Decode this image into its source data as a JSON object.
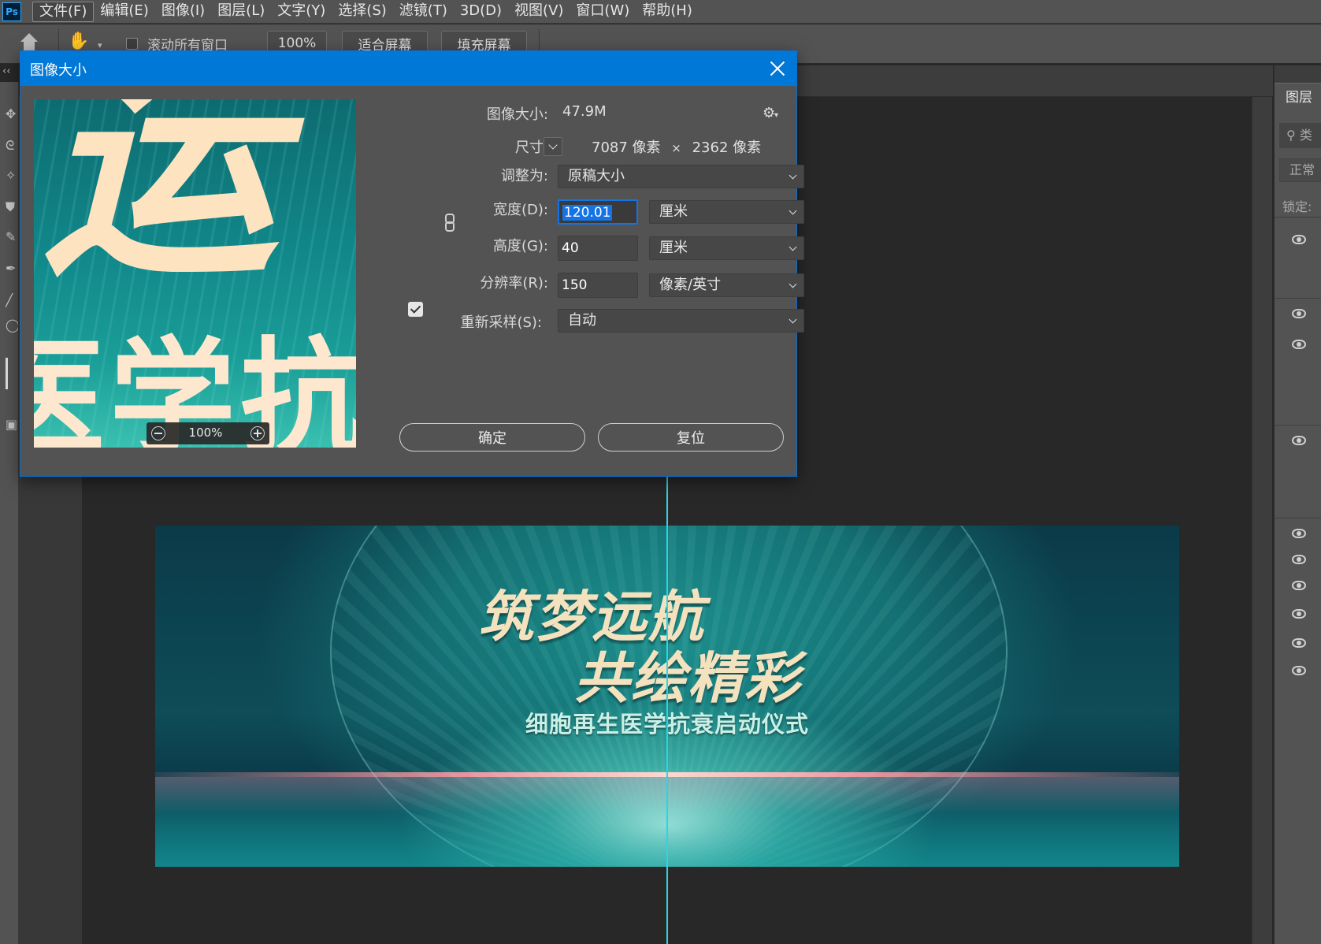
{
  "menubar": {
    "logo": "Ps",
    "items": [
      "文件(F)",
      "编辑(E)",
      "图像(I)",
      "图层(L)",
      "文字(Y)",
      "选择(S)",
      "滤镜(T)",
      "3D(D)",
      "视图(V)",
      "窗口(W)",
      "帮助(H)"
    ]
  },
  "options": {
    "scroll_all_label": "滚动所有窗口",
    "zoom_label": "100%",
    "fit_screen_label": "适合屏幕",
    "fill_screen_label": "填充屏幕"
  },
  "toolbar": {
    "collapse": "‹‹"
  },
  "banner": {
    "line1": "筑梦远航",
    "line2": "共绘精彩",
    "line3": "细胞再生医学抗衰启动仪式"
  },
  "right_panel": {
    "tab_label": "图层",
    "search_placeholder": "类",
    "blend_mode": "正常",
    "lock_label": "锁定:"
  },
  "dialog": {
    "title": "图像大小",
    "preview_zoom": "100%",
    "image_size_label": "图像大小:",
    "image_size_value": "47.9M",
    "dimensions_label": "尺寸:",
    "dim_width": "7087",
    "dim_unit1": "像素",
    "dim_x": "×",
    "dim_height": "2362",
    "dim_unit2": "像素",
    "fit_to_label": "调整为:",
    "fit_to_value": "原稿大小",
    "width_label": "宽度(D):",
    "width_value": "120.01",
    "width_unit": "厘米",
    "height_label": "高度(G):",
    "height_value": "40",
    "height_unit": "厘米",
    "resolution_label": "分辨率(R):",
    "resolution_value": "150",
    "resolution_unit": "像素/英寸",
    "resample_label": "重新采样(S):",
    "resample_value": "自动",
    "ok_label": "确定",
    "reset_label": "复位"
  }
}
